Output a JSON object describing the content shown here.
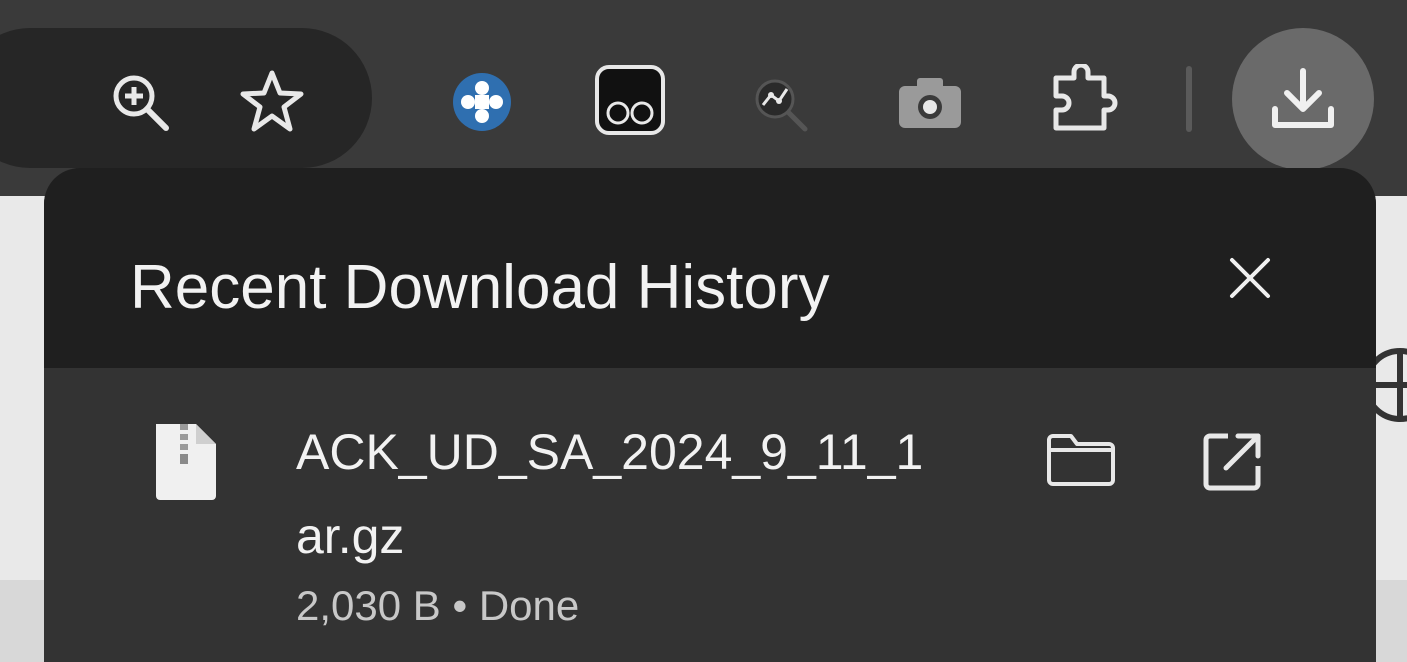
{
  "toolbar": {
    "icons": {
      "zoom": "zoom-in-icon",
      "bookmark": "star-icon",
      "extensions": [
        "plus-circle-extension-icon",
        "glasses-extension-icon",
        "graph-search-extension-icon",
        "camera-extension-icon",
        "puzzle-icon"
      ],
      "download": "download-icon"
    }
  },
  "popup": {
    "title": "Recent Download History",
    "close_icon": "close-icon"
  },
  "download_item": {
    "file_name_line1": "ACK_UD_SA_2024_9_11_1",
    "file_name_line2": "ar.gz",
    "meta": "2,030 B • Done",
    "file_icon": "archive-file-icon",
    "folder_icon": "folder-icon",
    "open_icon": "open-external-icon"
  },
  "colors": {
    "toolbar_bg": "#3a3a3a",
    "omnibox_bg": "#262626",
    "popup_header_bg": "#1f1f1f",
    "popup_body_bg": "#333333",
    "text_primary": "#f2f2f2",
    "text_secondary": "#c8c8c8",
    "extension_blue": "#2f6fb0"
  }
}
